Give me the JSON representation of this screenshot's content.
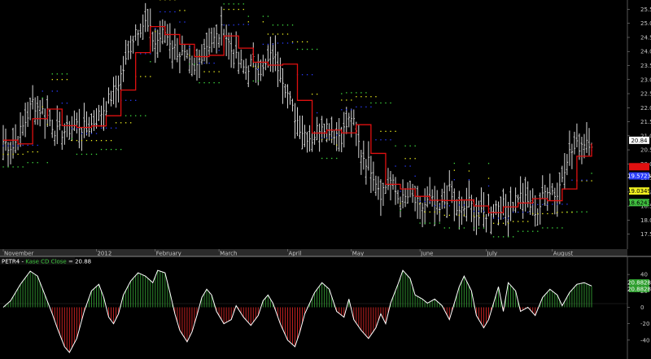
{
  "indicator": {
    "symbol": "PETR4",
    "separator": " - ",
    "name": "Kase CD Close",
    "equals": " = ",
    "value": "20.88"
  },
  "colors": {
    "background": "#000000",
    "bars": "#d8d8d8",
    "red_band": "#e01010",
    "blue_band": "#2a3cff",
    "yellow_band": "#f0f020",
    "green_band": "#40e040",
    "osc_pos": "#2e8b2e",
    "osc_neg": "#c02020",
    "osc_line": "#ffffff"
  },
  "chart_data": [
    {
      "type": "ohlc",
      "panel": "price",
      "ylim": [
        17.2,
        25.6
      ],
      "y_ticks": [
        "25.5",
        "25.0",
        "24.5",
        "24.0",
        "23.5",
        "23.0",
        "22.5",
        "22.0",
        "21.5",
        "21.0",
        "20.5",
        "20.0",
        "19.5",
        "19.0",
        "18.5",
        "18.0",
        "17.5"
      ],
      "x_labels": [
        {
          "label": "November",
          "index": 0
        },
        {
          "label": "2012",
          "index": 38
        },
        {
          "label": "February",
          "index": 62
        },
        {
          "label": "March",
          "index": 88
        },
        {
          "label": "April",
          "index": 116
        },
        {
          "label": "May",
          "index": 142
        },
        {
          "label": "June",
          "index": 170
        },
        {
          "label": "July",
          "index": 197
        },
        {
          "label": "August",
          "index": 224
        }
      ],
      "close_anchors": [
        [
          0,
          20.8
        ],
        [
          4,
          20.6
        ],
        [
          8,
          21.3
        ],
        [
          12,
          22.2
        ],
        [
          18,
          21.7
        ],
        [
          22,
          21.1
        ],
        [
          26,
          21.2
        ],
        [
          30,
          21.4
        ],
        [
          34,
          21.2
        ],
        [
          38,
          21.6
        ],
        [
          42,
          22.1
        ],
        [
          46,
          22.7
        ],
        [
          50,
          23.6
        ],
        [
          54,
          24.8
        ],
        [
          58,
          25.0
        ],
        [
          62,
          24.3
        ],
        [
          66,
          24.7
        ],
        [
          70,
          24.1
        ],
        [
          74,
          23.8
        ],
        [
          78,
          23.2
        ],
        [
          82,
          24.2
        ],
        [
          86,
          24.4
        ],
        [
          90,
          24.8
        ],
        [
          94,
          23.8
        ],
        [
          98,
          23.4
        ],
        [
          102,
          23.6
        ],
        [
          106,
          23.3
        ],
        [
          110,
          23.9
        ],
        [
          114,
          23.1
        ],
        [
          118,
          21.9
        ],
        [
          122,
          21.2
        ],
        [
          126,
          20.9
        ],
        [
          130,
          21.5
        ],
        [
          134,
          21.2
        ],
        [
          138,
          21.0
        ],
        [
          142,
          21.7
        ],
        [
          146,
          20.4
        ],
        [
          150,
          19.9
        ],
        [
          154,
          19.0
        ],
        [
          158,
          19.4
        ],
        [
          162,
          18.6
        ],
        [
          166,
          18.9
        ],
        [
          170,
          18.4
        ],
        [
          174,
          18.7
        ],
        [
          178,
          18.3
        ],
        [
          182,
          19.0
        ],
        [
          186,
          18.2
        ],
        [
          190,
          18.6
        ],
        [
          194,
          18.1
        ],
        [
          198,
          18.3
        ],
        [
          202,
          18.6
        ],
        [
          206,
          18.4
        ],
        [
          210,
          18.9
        ],
        [
          214,
          18.6
        ],
        [
          218,
          18.3
        ],
        [
          222,
          19.2
        ],
        [
          226,
          18.9
        ],
        [
          230,
          20.3
        ],
        [
          234,
          20.6
        ],
        [
          238,
          20.9
        ],
        [
          240,
          20.8
        ]
      ],
      "series": [
        {
          "name": "red",
          "last": "19.9"
        },
        {
          "name": "blue",
          "last": "19.5723"
        },
        {
          "name": "yellow",
          "last": "19.0349"
        },
        {
          "name": "green",
          "last": "18.6243"
        }
      ],
      "last_price": "20.84",
      "bar_count": 241
    },
    {
      "type": "histogram_line",
      "panel": "oscillator",
      "ylim": [
        -60,
        55
      ],
      "y_ticks": [
        "40",
        "20",
        "0",
        "-20",
        "-40"
      ],
      "badges": [
        "20.8828",
        "20.8828"
      ],
      "anchors": [
        [
          0,
          0
        ],
        [
          3,
          8
        ],
        [
          7,
          28
        ],
        [
          11,
          44
        ],
        [
          14,
          38
        ],
        [
          17,
          15
        ],
        [
          20,
          -8
        ],
        [
          22,
          -25
        ],
        [
          25,
          -48
        ],
        [
          27,
          -55
        ],
        [
          30,
          -38
        ],
        [
          33,
          -5
        ],
        [
          36,
          20
        ],
        [
          39,
          28
        ],
        [
          41,
          12
        ],
        [
          43,
          -12
        ],
        [
          45,
          -20
        ],
        [
          47,
          -8
        ],
        [
          49,
          15
        ],
        [
          52,
          32
        ],
        [
          55,
          42
        ],
        [
          58,
          38
        ],
        [
          61,
          30
        ],
        [
          63,
          45
        ],
        [
          66,
          42
        ],
        [
          68,
          18
        ],
        [
          70,
          -8
        ],
        [
          72,
          -28
        ],
        [
          75,
          -42
        ],
        [
          77,
          -30
        ],
        [
          79,
          -10
        ],
        [
          81,
          12
        ],
        [
          83,
          22
        ],
        [
          85,
          15
        ],
        [
          87,
          -5
        ],
        [
          90,
          -20
        ],
        [
          93,
          -15
        ],
        [
          95,
          2
        ],
        [
          98,
          -12
        ],
        [
          101,
          -22
        ],
        [
          104,
          -10
        ],
        [
          106,
          8
        ],
        [
          108,
          15
        ],
        [
          110,
          5
        ],
        [
          113,
          -20
        ],
        [
          116,
          -40
        ],
        [
          119,
          -48
        ],
        [
          121,
          -30
        ],
        [
          123,
          -8
        ],
        [
          125,
          5
        ],
        [
          127,
          18
        ],
        [
          130,
          30
        ],
        [
          133,
          22
        ],
        [
          136,
          -5
        ],
        [
          139,
          -12
        ],
        [
          141,
          10
        ],
        [
          143,
          -15
        ],
        [
          146,
          -28
        ],
        [
          149,
          -38
        ],
        [
          152,
          -25
        ],
        [
          154,
          -8
        ],
        [
          156,
          -20
        ],
        [
          158,
          5
        ],
        [
          161,
          28
        ],
        [
          163,
          45
        ],
        [
          166,
          35
        ],
        [
          168,
          15
        ],
        [
          171,
          10
        ],
        [
          173,
          5
        ],
        [
          176,
          10
        ],
        [
          179,
          2
        ],
        [
          182,
          -15
        ],
        [
          184,
          5
        ],
        [
          186,
          25
        ],
        [
          188,
          38
        ],
        [
          191,
          20
        ],
        [
          193,
          -10
        ],
        [
          196,
          -25
        ],
        [
          198,
          -15
        ],
        [
          200,
          5
        ],
        [
          202,
          25
        ],
        [
          204,
          -5
        ],
        [
          206,
          30
        ],
        [
          209,
          20
        ],
        [
          211,
          -5
        ],
        [
          214,
          0
        ],
        [
          217,
          -10
        ],
        [
          220,
          12
        ],
        [
          223,
          22
        ],
        [
          226,
          15
        ],
        [
          228,
          2
        ],
        [
          231,
          18
        ],
        [
          234,
          28
        ],
        [
          237,
          30
        ],
        [
          240,
          26
        ]
      ]
    }
  ]
}
